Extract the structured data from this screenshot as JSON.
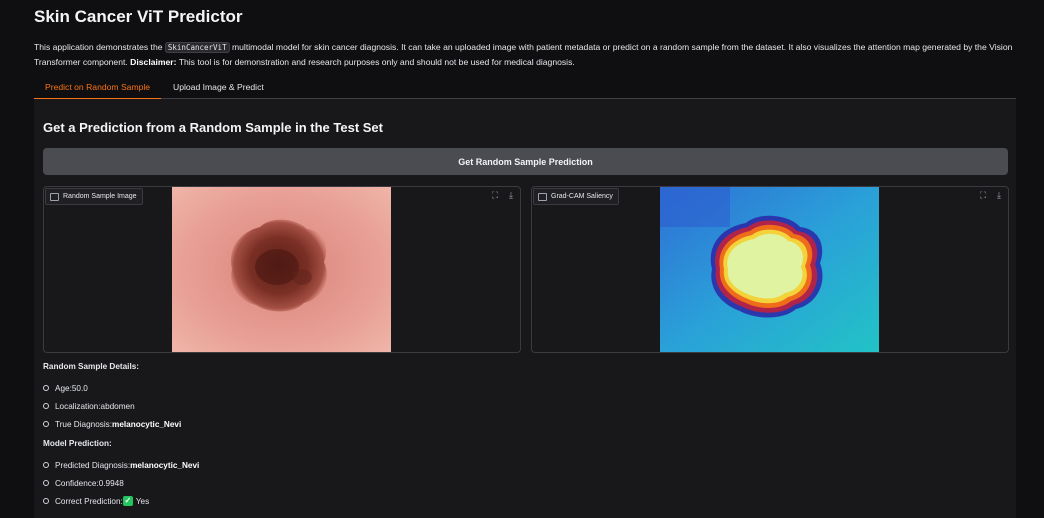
{
  "app": {
    "title": "Skin Cancer ViT Predictor",
    "desc_part1": "This application demonstrates the ",
    "desc_code": "SkinCancerViT",
    "desc_part2": " multimodal model for skin cancer diagnosis. It can take an uploaded image with patient metadata or predict on a random sample from the dataset. It also visualizes the attention map generated by the Vision Transformer component. ",
    "desc_bold": "Disclaimer:",
    "desc_part3": " This tool is for demonstration and research purposes only and should not be used for medical diagnosis."
  },
  "tabs": [
    "Predict on Random Sample",
    "Upload Image & Predict"
  ],
  "section_title": "Get a Prediction from a Random Sample in the Test Set",
  "button_label": "Get Random Sample Prediction",
  "panels": {
    "left_label": "Random Sample Image",
    "right_label": "Grad-CAM Saliency"
  },
  "details": {
    "heading": "Random Sample Details:",
    "age_label": "Age: ",
    "age": "50.0",
    "loc_label": "Localization: ",
    "loc": "abdomen",
    "true_label": "True Diagnosis: ",
    "true_dx": "melanocytic_Nevi"
  },
  "prediction": {
    "heading": "Model Prediction:",
    "pred_label": "Predicted Diagnosis: ",
    "pred_dx": "melanocytic_Nevi",
    "conf_label": "Confidence: ",
    "conf": "0.9948",
    "correct_label": "Correct Prediction: ",
    "correct_icon": "check-mark-icon",
    "correct_value": "Yes"
  },
  "colors": {
    "accent": "#f97316",
    "background": "#0f0f11",
    "button": "#4b4b52"
  }
}
